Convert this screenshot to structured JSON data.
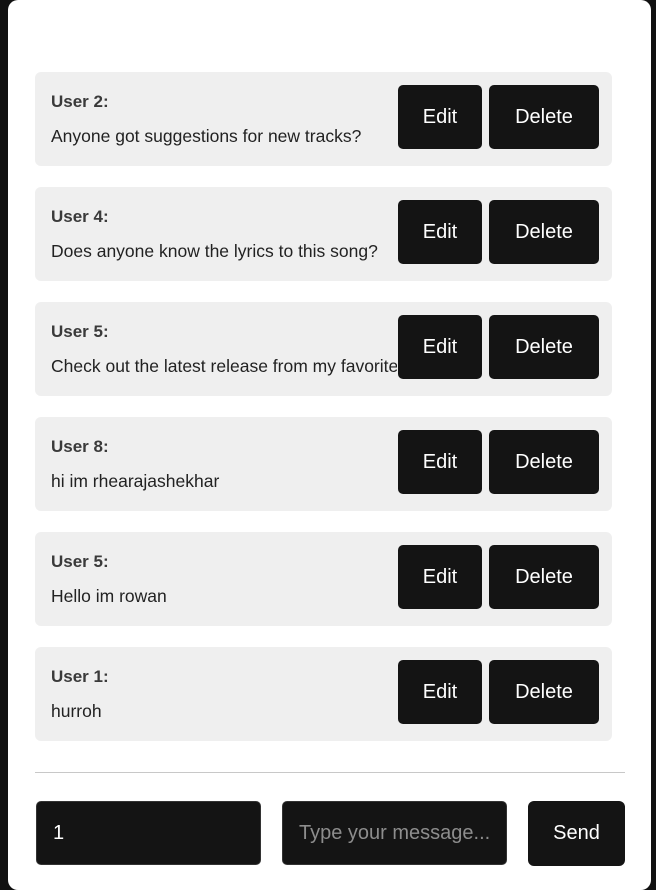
{
  "messages": [
    {
      "user": "User 2:",
      "text": "Anyone got suggestions for new tracks?"
    },
    {
      "user": "User 4:",
      "text": "Does anyone know the lyrics to this song?"
    },
    {
      "user": "User 5:",
      "text": "Check out the latest release from my favorite artist!"
    },
    {
      "user": "User 8:",
      "text": "hi im rhearajashekhar"
    },
    {
      "user": "User 5:",
      "text": "Hello im rowan"
    },
    {
      "user": "User 1:",
      "text": "hurroh"
    }
  ],
  "actions": {
    "edit_label": "Edit",
    "delete_label": "Delete"
  },
  "composer": {
    "user_id_value": "1",
    "message_placeholder": "Type your message...",
    "send_label": "Send"
  },
  "colors": {
    "background": "#111111",
    "panel": "#ffffff",
    "card": "#efefef",
    "button": "#141414"
  }
}
